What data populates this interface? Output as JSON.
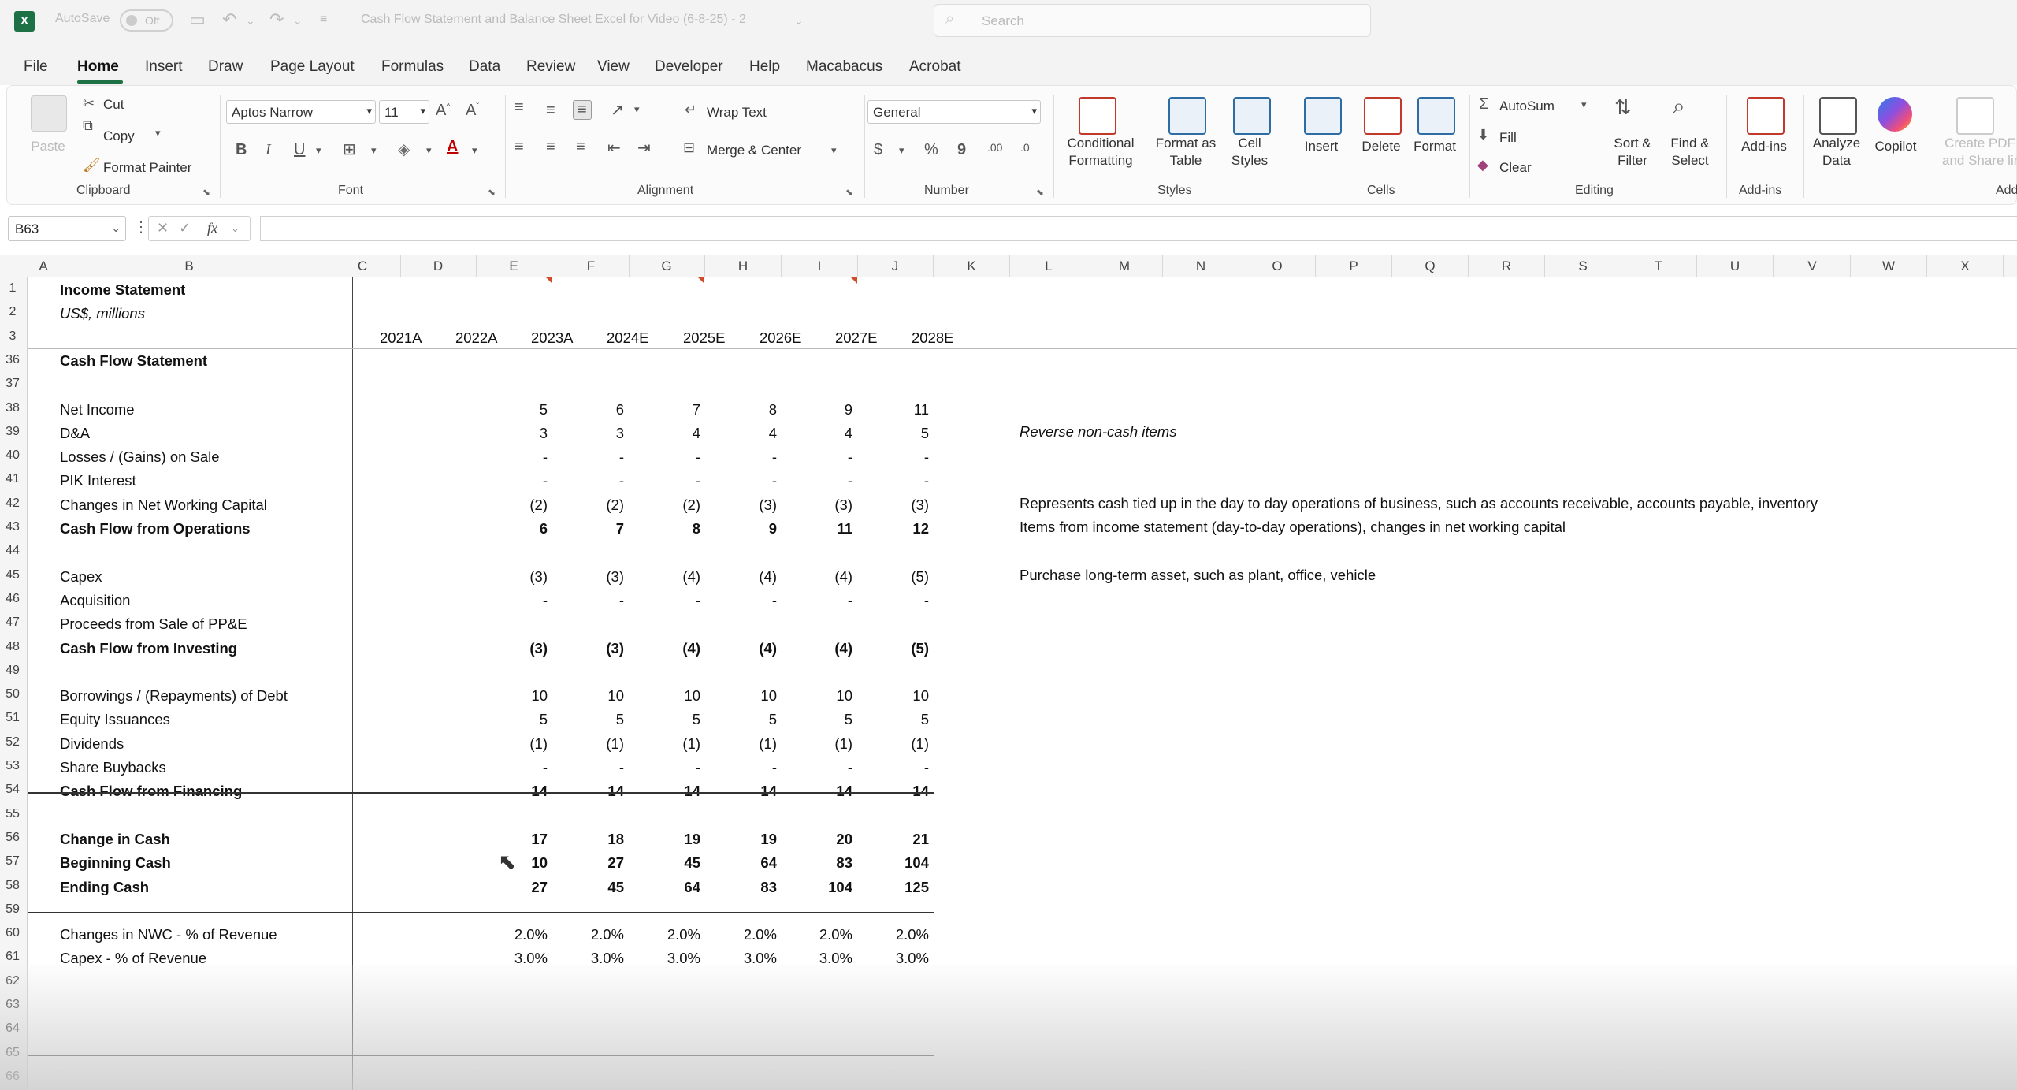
{
  "titlebar": {
    "app_icon": "X",
    "autosave_label": "AutoSave",
    "autosave_state": "Off",
    "doc_title": "Cash Flow Statement and Balance Sheet Excel for Video (6-8-25)  -  2",
    "search_placeholder": "Search"
  },
  "menu": {
    "tabs": [
      "File",
      "Home",
      "Insert",
      "Draw",
      "Page Layout",
      "Formulas",
      "Data",
      "Review",
      "View",
      "Developer",
      "Help",
      "Macabacus",
      "Acrobat"
    ],
    "active": "Home"
  },
  "ribbon": {
    "clipboard": {
      "paste": "Paste",
      "cut": "Cut",
      "copy": "Copy",
      "format_painter": "Format Painter",
      "group": "Clipboard"
    },
    "font": {
      "name": "Aptos Narrow",
      "size": "11",
      "bold": "B",
      "italic": "I",
      "underline": "U",
      "group": "Font"
    },
    "alignment": {
      "wrap": "Wrap Text",
      "merge": "Merge & Center",
      "group": "Alignment"
    },
    "number": {
      "format": "General",
      "currency": "$",
      "percent": "%",
      "comma": "9",
      "group": "Number"
    },
    "styles": {
      "conditional_1": "Conditional",
      "conditional_2": "Formatting",
      "format_table_1": "Format as",
      "format_table_2": "Table",
      "cell_styles_1": "Cell",
      "cell_styles_2": "Styles",
      "group": "Styles"
    },
    "cells": {
      "insert": "Insert",
      "delete": "Delete",
      "format": "Format",
      "group": "Cells"
    },
    "editing": {
      "autosum": "AutoSum",
      "fill": "Fill",
      "clear": "Clear",
      "sort_1": "Sort &",
      "sort_2": "Filter",
      "find_1": "Find &",
      "find_2": "Select",
      "group": "Editing"
    },
    "addins": {
      "addins": "Add-ins",
      "group": "Add-ins",
      "analyze_1": "Analyze",
      "analyze_2": "Data",
      "copilot": "Copilot",
      "pdf_1": "Create PDF",
      "pdf_2": "and Share lin",
      "group_cut": "Add"
    }
  },
  "formula_bar": {
    "name_box": "B63",
    "fx": "fx",
    "content": ""
  },
  "columns": [
    "A",
    "B",
    "C",
    "D",
    "E",
    "F",
    "G",
    "H",
    "I",
    "J",
    "K",
    "L",
    "M",
    "N",
    "O",
    "P",
    "Q",
    "R",
    "S",
    "T",
    "U",
    "V",
    "W",
    "X"
  ],
  "rows": [
    "1",
    "2",
    "3",
    "36",
    "37",
    "38",
    "39",
    "40",
    "41",
    "42",
    "43",
    "44",
    "45",
    "46",
    "47",
    "48",
    "49",
    "50",
    "51",
    "52",
    "53",
    "54",
    "55",
    "56",
    "57",
    "58",
    "59",
    "60",
    "61",
    "62",
    "63",
    "64",
    "65",
    "66"
  ],
  "header": {
    "title": "Income Statement",
    "units": "US$, millions",
    "section": "Cash Flow Statement"
  },
  "years": [
    "2021A",
    "2022A",
    "2023A",
    "2024E",
    "2025E",
    "2026E",
    "2027E",
    "2028E"
  ],
  "lines": [
    {
      "label": "Net Income",
      "bold": false,
      "values": [
        "5",
        "6",
        "7",
        "8",
        "9",
        "11"
      ]
    },
    {
      "label": "D&A",
      "bold": false,
      "values": [
        "3",
        "3",
        "4",
        "4",
        "4",
        "5"
      ]
    },
    {
      "label": "Losses / (Gains) on Sale",
      "bold": false,
      "values": [
        "-",
        "-",
        "-",
        "-",
        "-",
        "-"
      ]
    },
    {
      "label": "PIK Interest",
      "bold": false,
      "values": [
        "-",
        "-",
        "-",
        "-",
        "-",
        "-"
      ]
    },
    {
      "label": "Changes in Net Working Capital",
      "bold": false,
      "values": [
        "(2)",
        "(2)",
        "(2)",
        "(3)",
        "(3)",
        "(3)"
      ]
    },
    {
      "label": "Cash Flow from Operations",
      "bold": true,
      "values": [
        "6",
        "7",
        "8",
        "9",
        "11",
        "12"
      ]
    },
    {
      "label": "Capex",
      "bold": false,
      "values": [
        "(3)",
        "(3)",
        "(4)",
        "(4)",
        "(4)",
        "(5)"
      ]
    },
    {
      "label": "Acquisition",
      "bold": false,
      "values": [
        "-",
        "-",
        "-",
        "-",
        "-",
        "-"
      ]
    },
    {
      "label": "Proceeds from Sale of PP&E",
      "bold": false,
      "values": [
        "",
        "",
        "",
        "",
        "",
        ""
      ]
    },
    {
      "label": "Cash Flow from Investing",
      "bold": true,
      "values": [
        "(3)",
        "(3)",
        "(4)",
        "(4)",
        "(4)",
        "(5)"
      ]
    },
    {
      "label": "Borrowings / (Repayments) of Debt",
      "bold": false,
      "values": [
        "10",
        "10",
        "10",
        "10",
        "10",
        "10"
      ]
    },
    {
      "label": "Equity Issuances",
      "bold": false,
      "values": [
        "5",
        "5",
        "5",
        "5",
        "5",
        "5"
      ]
    },
    {
      "label": "Dividends",
      "bold": false,
      "values": [
        "(1)",
        "(1)",
        "(1)",
        "(1)",
        "(1)",
        "(1)"
      ]
    },
    {
      "label": "Share Buybacks",
      "bold": false,
      "values": [
        "-",
        "-",
        "-",
        "-",
        "-",
        "-"
      ]
    },
    {
      "label": "Cash Flow from Financing",
      "bold": true,
      "values": [
        "14",
        "14",
        "14",
        "14",
        "14",
        "14"
      ]
    },
    {
      "label": "Change in Cash",
      "bold": true,
      "values": [
        "17",
        "18",
        "19",
        "19",
        "20",
        "21"
      ]
    },
    {
      "label": "Beginning Cash",
      "bold": true,
      "values": [
        "10",
        "27",
        "45",
        "64",
        "83",
        "104"
      ]
    },
    {
      "label": "Ending Cash",
      "bold": true,
      "values": [
        "27",
        "45",
        "64",
        "83",
        "104",
        "125"
      ]
    },
    {
      "label": "Changes in NWC - % of Revenue",
      "bold": false,
      "values": [
        "2.0%",
        "2.0%",
        "2.0%",
        "2.0%",
        "2.0%",
        "2.0%"
      ]
    },
    {
      "label": "Capex - % of Revenue",
      "bold": false,
      "values": [
        "3.0%",
        "3.0%",
        "3.0%",
        "3.0%",
        "3.0%",
        "3.0%"
      ]
    }
  ],
  "notes": {
    "reverse": "Reverse non-cash items",
    "nwc_1": "Represents cash tied up in the day to day operations of business, such as accounts receivable, accounts payable, inventory",
    "nwc_2": "Items from income statement (day-to-day operations), changes in net working capital",
    "capex": "Purchase long-term asset, such as plant, office, vehicle"
  }
}
